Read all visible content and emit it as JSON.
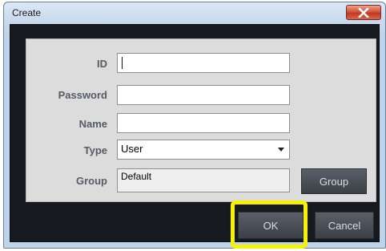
{
  "window": {
    "title": "Create"
  },
  "form": {
    "id_label": "ID",
    "id_value": "",
    "password_label": "Password",
    "password_value": "",
    "name_label": "Name",
    "name_value": "",
    "type_label": "Type",
    "type_value": "User",
    "group_label": "Group",
    "group_value": "Default",
    "group_button": "Group"
  },
  "buttons": {
    "ok": "OK",
    "cancel": "Cancel"
  },
  "colors": {
    "highlight": "#f7f200",
    "close_button": "#c9462c",
    "dark_background": "#16191d",
    "panel": "#dcdcdc"
  },
  "icons": {
    "close": "close-icon",
    "dropdown": "chevron-down-icon"
  }
}
